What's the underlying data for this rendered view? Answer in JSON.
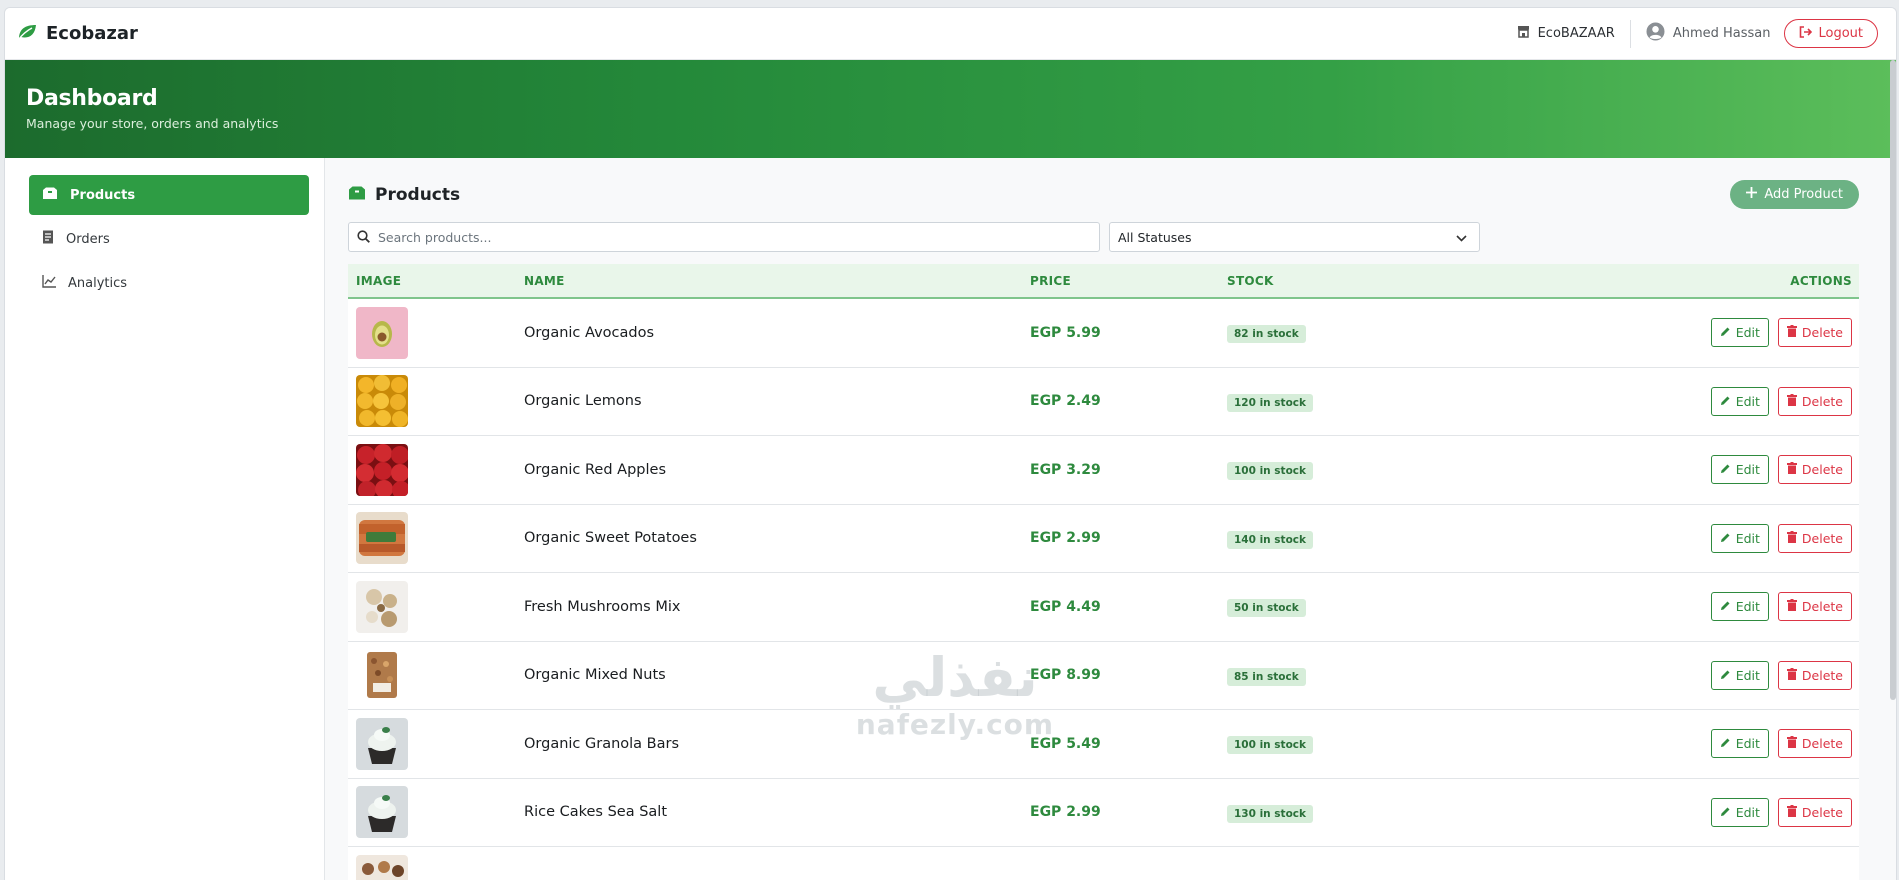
{
  "navbar": {
    "brand": "Ecobazar",
    "store_label": "EcoBAZAAR",
    "user_name": "Ahmed Hassan",
    "logout_label": "Logout"
  },
  "hero": {
    "title": "Dashboard",
    "subtitle": "Manage your store, orders and analytics"
  },
  "sidebar": {
    "items": [
      {
        "label": "Products",
        "icon": "box-icon",
        "active": true
      },
      {
        "label": "Orders",
        "icon": "receipt-icon",
        "active": false
      },
      {
        "label": "Analytics",
        "icon": "chart-line-icon",
        "active": false
      }
    ]
  },
  "products_panel": {
    "title": "Products",
    "add_button": "Add Product",
    "search_placeholder": "Search products...",
    "status_filter": "All Statuses",
    "columns": [
      "IMAGE",
      "NAME",
      "PRICE",
      "STOCK",
      "ACTIONS"
    ],
    "edit_label": "Edit",
    "delete_label": "Delete",
    "rows": [
      {
        "name": "Organic Avocados",
        "price": "EGP 5.99",
        "stock": "82 in stock",
        "image": "avocado"
      },
      {
        "name": "Organic Lemons",
        "price": "EGP 2.49",
        "stock": "120 in stock",
        "image": "lemons"
      },
      {
        "name": "Organic Red Apples",
        "price": "EGP 3.29",
        "stock": "100 in stock",
        "image": "apples"
      },
      {
        "name": "Organic Sweet Potatoes",
        "price": "EGP 2.99",
        "stock": "140 in stock",
        "image": "sweet-potatoes"
      },
      {
        "name": "Fresh Mushrooms Mix",
        "price": "EGP 4.49",
        "stock": "50 in stock",
        "image": "mushrooms"
      },
      {
        "name": "Organic Mixed Nuts",
        "price": "EGP 8.99",
        "stock": "85 in stock",
        "image": "nuts-bag"
      },
      {
        "name": "Organic Granola Bars",
        "price": "EGP 5.49",
        "stock": "100 in stock",
        "image": "cupcake"
      },
      {
        "name": "Rice Cakes Sea Salt",
        "price": "EGP 2.99",
        "stock": "130 in stock",
        "image": "cupcake"
      }
    ]
  },
  "watermark": {
    "arabic": "نفذلي",
    "latin": "nafezly.com"
  },
  "colors": {
    "primary": "#2e9c44",
    "danger": "#dc3545",
    "accent_text": "#2e8a3e"
  }
}
